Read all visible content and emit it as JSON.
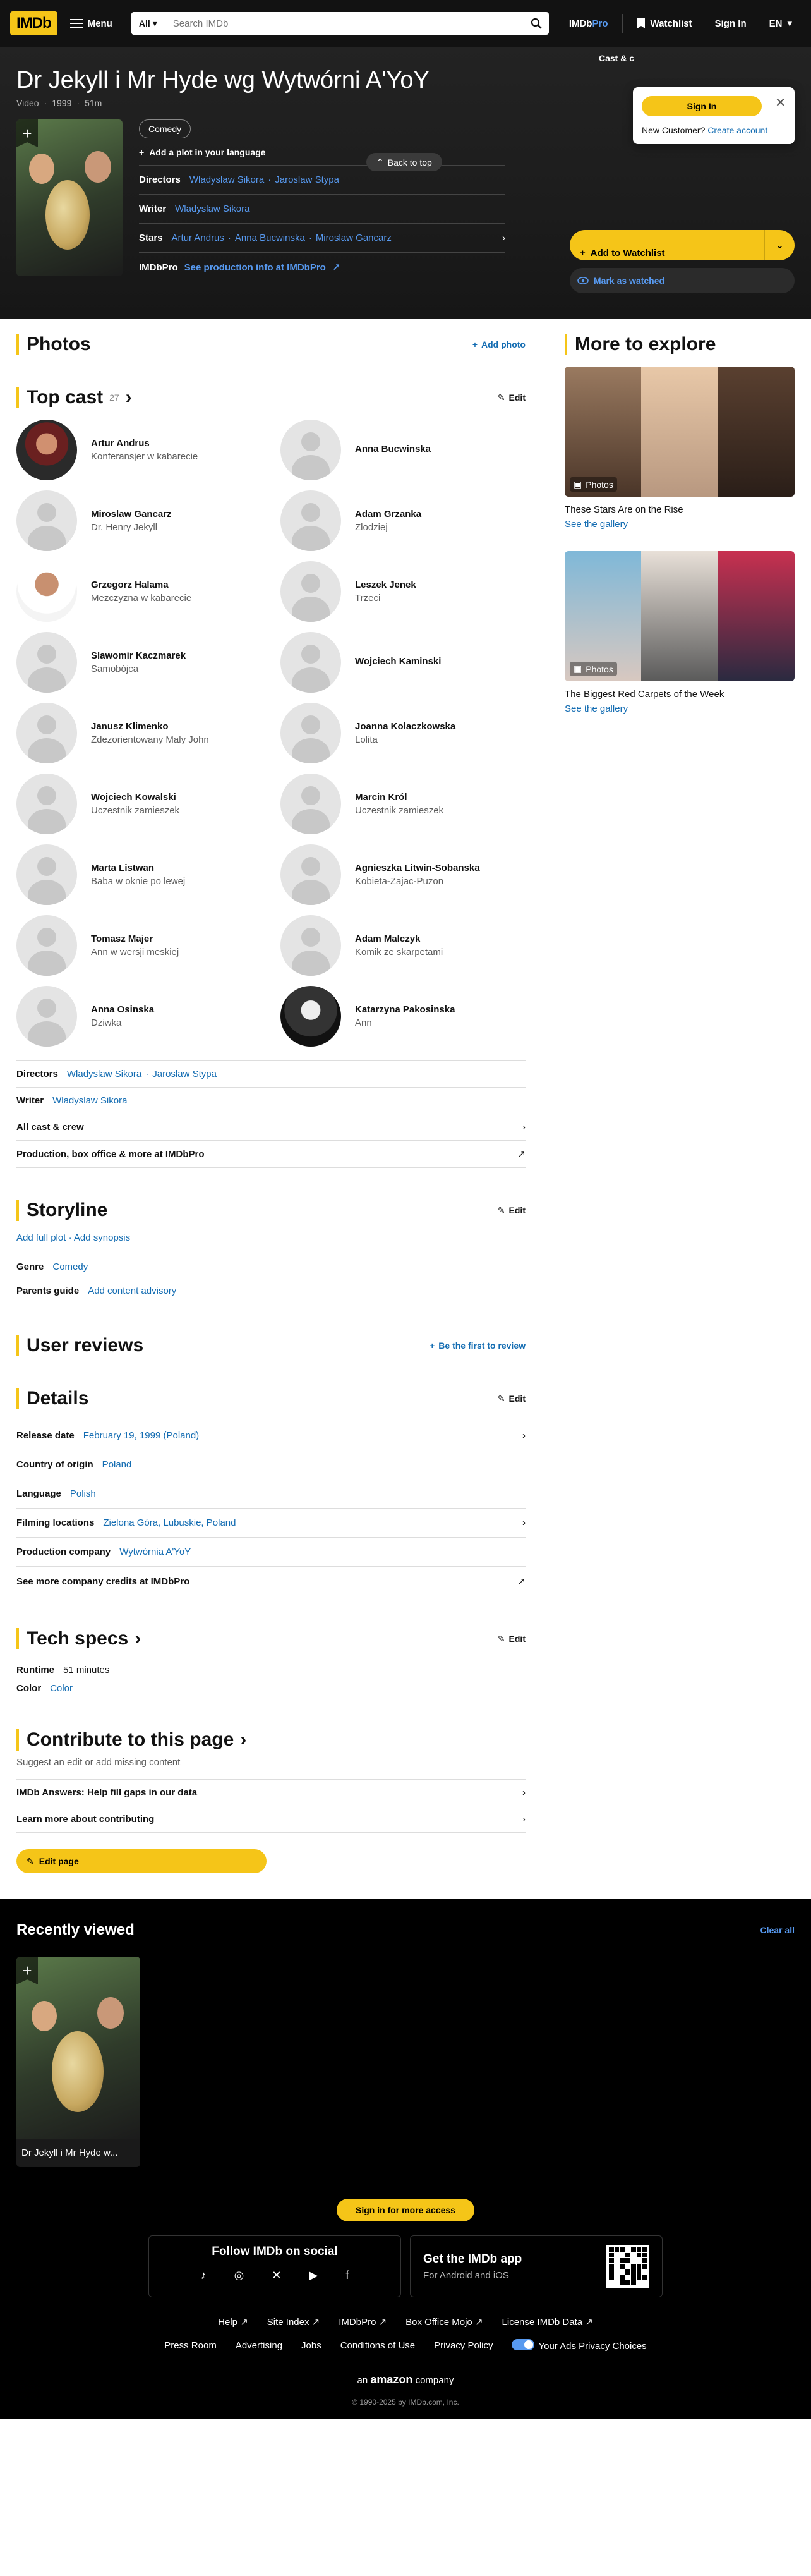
{
  "nav": {
    "logo": "IMDb",
    "menu": "Menu",
    "search_category": "All",
    "search_placeholder": "Search IMDb",
    "pro_a": "IMDb",
    "pro_b": "Pro",
    "watchlist": "Watchlist",
    "sign_in": "Sign In",
    "lang": "EN"
  },
  "popup": {
    "sign_in": "Sign In",
    "new_customer": "New Customer?",
    "create_account": "Create account"
  },
  "hero": {
    "cast_crew": "Cast & c",
    "title": "Dr Jekyll i Mr Hyde wg Wytwórni A'YoY",
    "meta": [
      "Video",
      "1999",
      "51m"
    ],
    "back_top": "Back to top",
    "genre": "Comedy",
    "add_plot": "Add a plot in your language",
    "directors_label": "Directors",
    "directors": [
      "Wladyslaw Sikora",
      "Jaroslaw Stypa"
    ],
    "writer_label": "Writer",
    "writer": "Wladyslaw Sikora",
    "stars_label": "Stars",
    "stars": [
      "Artur Andrus",
      "Anna Bucwinska",
      "Miroslaw Gancarz"
    ],
    "imdbpro": "IMDbPro",
    "prod_info": "See production info at IMDbPro",
    "add_watchlist": "Add to Watchlist",
    "mark_watched": "Mark as watched"
  },
  "photos": {
    "title": "Photos",
    "add": "Add photo"
  },
  "cast": {
    "title": "Top cast",
    "count": "27",
    "edit": "Edit",
    "members": [
      {
        "name": "Artur Andrus",
        "role": "Konferansjer w kabarecie"
      },
      {
        "name": "Anna Bucwinska",
        "role": ""
      },
      {
        "name": "Miroslaw Gancarz",
        "role": "Dr. Henry Jekyll"
      },
      {
        "name": "Adam Grzanka",
        "role": "Zlodziej"
      },
      {
        "name": "Grzegorz Halama",
        "role": "Mezczyzna w kabarecie"
      },
      {
        "name": "Leszek Jenek",
        "role": "Trzeci"
      },
      {
        "name": "Slawomir Kaczmarek",
        "role": "Samobójca"
      },
      {
        "name": "Wojciech Kaminski",
        "role": ""
      },
      {
        "name": "Janusz Klimenko",
        "role": "Zdezorientowany Maly John"
      },
      {
        "name": "Joanna Kolaczkowska",
        "role": "Lolita"
      },
      {
        "name": "Wojciech Kowalski",
        "role": "Uczestnik zamieszek"
      },
      {
        "name": "Marcin Król",
        "role": "Uczestnik zamieszek"
      },
      {
        "name": "Marta Listwan",
        "role": "Baba w oknie po lewej"
      },
      {
        "name": "Agnieszka Litwin-Sobanska",
        "role": "Kobieta-Zajac-Puzon"
      },
      {
        "name": "Tomasz Majer",
        "role": "Ann w wersji meskiej"
      },
      {
        "name": "Adam Malczyk",
        "role": "Komik ze skarpetami"
      },
      {
        "name": "Anna Osinska",
        "role": "Dziwka"
      },
      {
        "name": "Katarzyna Pakosinska",
        "role": "Ann"
      }
    ],
    "directors_label": "Directors",
    "directors": [
      "Wladyslaw Sikora",
      "Jaroslaw Stypa"
    ],
    "writer_label": "Writer",
    "writer": "Wladyslaw Sikora",
    "all_cast": "All cast & crew",
    "production": "Production, box office & more at IMDbPro"
  },
  "storyline": {
    "title": "Storyline",
    "edit": "Edit",
    "add_full_plot": "Add full plot",
    "add_synopsis": "Add synopsis",
    "genre_label": "Genre",
    "genre": "Comedy",
    "parents_label": "Parents guide",
    "parents": "Add content advisory"
  },
  "reviews": {
    "title": "User reviews",
    "first": "Be the first to review"
  },
  "details": {
    "title": "Details",
    "edit": "Edit",
    "rows": [
      {
        "label": "Release date",
        "value": "February 19, 1999 (Poland)"
      },
      {
        "label": "Country of origin",
        "value": "Poland"
      },
      {
        "label": "Language",
        "value": "Polish"
      },
      {
        "label": "Filming locations",
        "value": "Zielona Góra, Lubuskie, Poland"
      },
      {
        "label": "Production company",
        "value": "Wytwórnia A'YoY"
      }
    ],
    "more_credits": "See more company credits at IMDbPro"
  },
  "tech": {
    "title": "Tech specs",
    "edit": "Edit",
    "runtime_label": "Runtime",
    "runtime": "51 minutes",
    "color_label": "Color",
    "color": "Color"
  },
  "contribute": {
    "title": "Contribute to this page",
    "sub": "Suggest an edit or add missing content",
    "answers": "IMDb Answers: Help fill gaps in our data",
    "learn": "Learn more about contributing",
    "edit_page": "Edit page"
  },
  "explore": {
    "title": "More to explore",
    "cards": [
      {
        "badge": "Photos",
        "text": "These Stars Are on the Rise",
        "link": "See the gallery"
      },
      {
        "badge": "Photos",
        "text": "The Biggest Red Carpets of the Week",
        "link": "See the gallery"
      }
    ]
  },
  "recent": {
    "title": "Recently viewed",
    "clear": "Clear all",
    "item": "Dr Jekyll i Mr Hyde w..."
  },
  "footer": {
    "sign_more": "Sign in for more access",
    "follow": "Follow IMDb on social",
    "app_title": "Get the IMDb app",
    "app_sub": "For Android and iOS",
    "links1": [
      "Help",
      "Site Index",
      "IMDbPro",
      "Box Office Mojo",
      "License IMDb Data"
    ],
    "links2": [
      "Press Room",
      "Advertising",
      "Jobs",
      "Conditions of Use",
      "Privacy Policy"
    ],
    "privacy_choices": "Your Ads Privacy Choices",
    "amazon_a": "an",
    "amazon_b": "amazon",
    "amazon_c": "company",
    "copyright": "© 1990-2025 by IMDb.com, Inc."
  }
}
